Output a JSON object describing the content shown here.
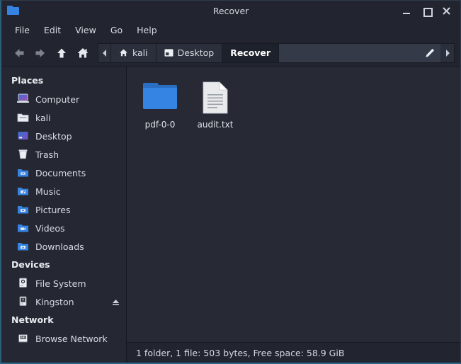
{
  "window": {
    "title": "Recover",
    "icon": "folder-icon",
    "controls": [
      {
        "name": "minimize-button",
        "label": "_"
      },
      {
        "name": "maximize-button",
        "label": "□"
      },
      {
        "name": "close-button",
        "label": "✕"
      }
    ]
  },
  "menubar": {
    "items": [
      {
        "label": "File"
      },
      {
        "label": "Edit"
      },
      {
        "label": "View"
      },
      {
        "label": "Go"
      },
      {
        "label": "Help"
      }
    ]
  },
  "toolbar": {
    "nav": [
      {
        "name": "back-button",
        "icon": "arrow-left-icon",
        "enabled": false
      },
      {
        "name": "forward-button",
        "icon": "arrow-right-icon",
        "enabled": false
      },
      {
        "name": "up-button",
        "icon": "arrow-up-icon",
        "enabled": true
      },
      {
        "name": "home-button",
        "icon": "home-icon",
        "enabled": true
      }
    ],
    "breadcrumbs": [
      {
        "label": "kali",
        "icon": "home-icon",
        "active": false
      },
      {
        "label": "Desktop",
        "icon": "desktop-icon",
        "active": false
      },
      {
        "label": "Recover",
        "icon": "",
        "active": true
      }
    ],
    "path_entry": {
      "value": "",
      "placeholder": "",
      "edit_icon": "pencil-icon"
    },
    "scroll_left_icon": "triangle-left-icon",
    "scroll_right_icon": "triangle-right-icon"
  },
  "sidebar": {
    "groups": [
      {
        "title": "Places",
        "items": [
          {
            "label": "Computer",
            "icon": "computer-icon"
          },
          {
            "label": "kali",
            "icon": "home-folder-icon"
          },
          {
            "label": "Desktop",
            "icon": "desktop-icon"
          },
          {
            "label": "Trash",
            "icon": "trash-icon"
          },
          {
            "label": "Documents",
            "icon": "documents-folder-icon"
          },
          {
            "label": "Music",
            "icon": "music-folder-icon"
          },
          {
            "label": "Pictures",
            "icon": "pictures-folder-icon"
          },
          {
            "label": "Videos",
            "icon": "videos-folder-icon"
          },
          {
            "label": "Downloads",
            "icon": "downloads-folder-icon"
          }
        ]
      },
      {
        "title": "Devices",
        "items": [
          {
            "label": "File System",
            "icon": "harddisk-icon"
          },
          {
            "label": "Kingston",
            "icon": "usb-drive-icon",
            "eject": true
          }
        ]
      },
      {
        "title": "Network",
        "items": [
          {
            "label": "Browse Network",
            "icon": "network-icon"
          }
        ]
      }
    ]
  },
  "files": [
    {
      "name": "pdf-0-0",
      "type": "folder",
      "icon": "folder-icon"
    },
    {
      "name": "audit.txt",
      "type": "file",
      "icon": "text-document-icon"
    }
  ],
  "statusbar": {
    "text": "1 folder, 1 file: 503 bytes, Free space: 58.9 GiB"
  },
  "colors": {
    "window_bg": "#22252f",
    "sidebar_bg": "#252833",
    "content_bg": "#272a35",
    "accent_blue": "#3584e4",
    "text": "#d7dbe2",
    "active_border": "#2b6a8a"
  }
}
